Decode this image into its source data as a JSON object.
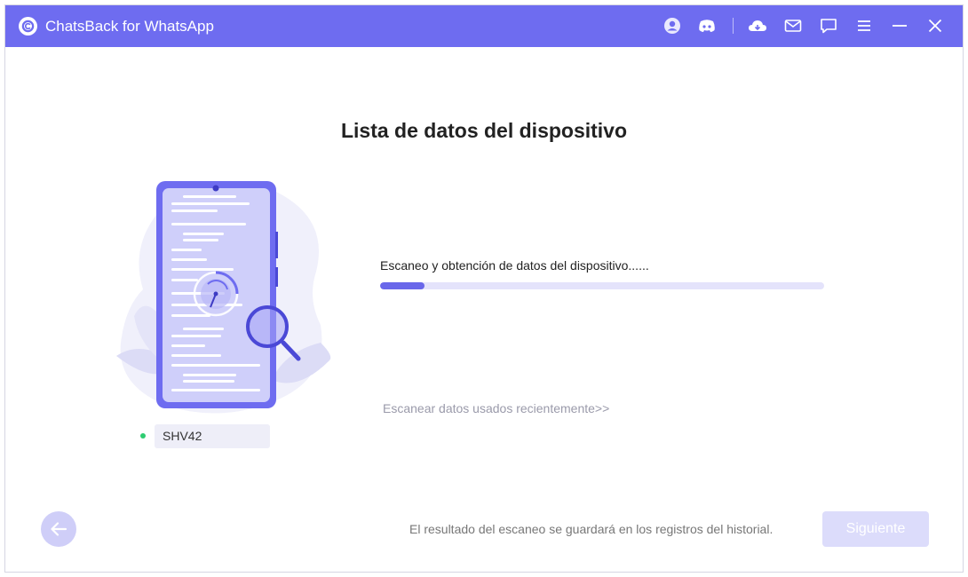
{
  "titlebar": {
    "app_title": "ChatsBack for WhatsApp",
    "icons": [
      "account-icon",
      "discord-icon",
      "cloud-icon",
      "mail-icon",
      "feedback-icon",
      "menu-icon",
      "minimize-icon",
      "close-icon"
    ]
  },
  "main": {
    "title": "Lista de datos del dispositivo",
    "device_name": "SHV42",
    "scan_status": "Escaneo y obtención de datos del dispositivo......",
    "progress": 0.1,
    "recent_link": "Escanear datos usados recientemente>>"
  },
  "footer": {
    "note": "El resultado del escaneo se guardará en los registros del historial.",
    "next_label": "Siguiente"
  },
  "colors": {
    "accent": "#6e6cf0",
    "progress_fill": "#6967ea",
    "progress_track": "#e4e3fb",
    "online_dot": "#2ecc71"
  }
}
